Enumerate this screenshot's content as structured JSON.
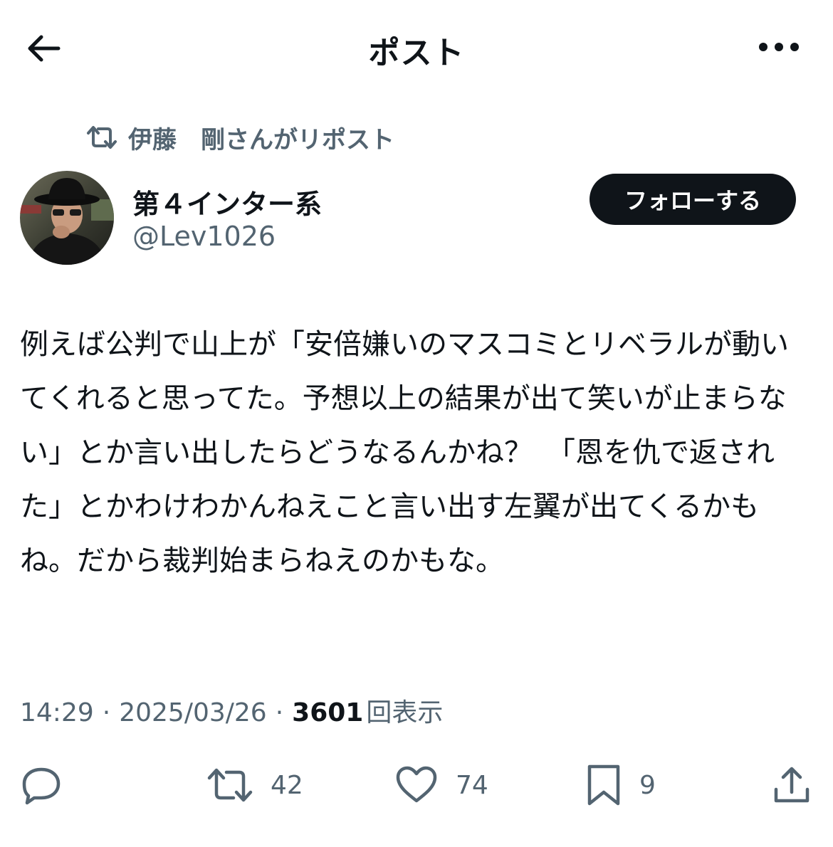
{
  "header": {
    "title": "ポスト",
    "back_icon": "arrow-left-icon",
    "more_icon": "more-horizontal-icon"
  },
  "repost": {
    "text": "伊藤　剛さんがリポスト",
    "icon": "repost-icon"
  },
  "author": {
    "name": "第４インター系",
    "handle": "@Lev1026",
    "follow_label": "フォローする"
  },
  "tweet": {
    "text": "例えば公判で山上が「安倍嫌いのマスコミとリベラルが動いてくれると思ってた。予想以上の結果が出て笑いが止まらない」とか言い出したらどうなるんかね？　「恩を仇で返された」とかわけわかんねえこと言い出す左翼が出てくるかもね。だから裁判始まらねえのかもな。"
  },
  "meta": {
    "time": "14:29",
    "sep1": "·",
    "date": "2025/03/26",
    "sep2": "·",
    "views_count": "3601",
    "views_label": "回表示"
  },
  "actions": {
    "reply_icon": "reply-icon",
    "repost_count": "42",
    "like_count": "74",
    "bookmark_count": "9",
    "share_icon": "share-icon"
  },
  "colors": {
    "text_primary": "#0f1419",
    "text_secondary": "#536471",
    "follow_bg": "#0f1419",
    "background": "#ffffff"
  }
}
